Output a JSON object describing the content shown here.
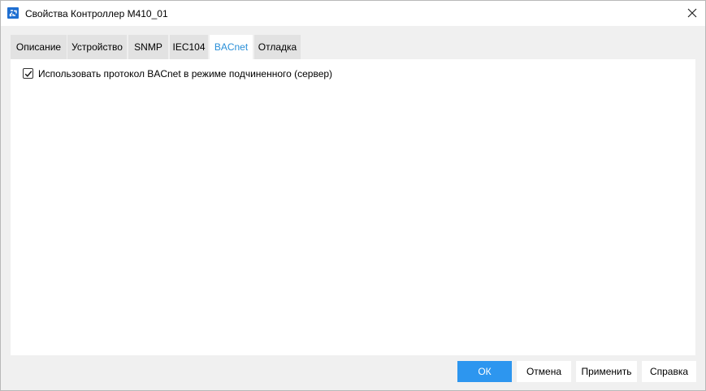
{
  "window": {
    "title": "Свойства Контроллер М410_01",
    "icon": "app-icon",
    "close_icon": "close-icon"
  },
  "tabs": [
    {
      "label": "Описание",
      "active": false
    },
    {
      "label": "Устройство",
      "active": false
    },
    {
      "label": "SNMP",
      "active": false
    },
    {
      "label": "IEC104",
      "active": false
    },
    {
      "label": "BACnet",
      "active": true
    },
    {
      "label": "Отладка",
      "active": false
    }
  ],
  "bacnet": {
    "use_bacnet_checkbox": {
      "label": "Использовать протокол BACnet в режиме подчиненного (сервер)",
      "checked": true
    }
  },
  "buttons": {
    "ok": "ОК",
    "cancel": "Отмена",
    "apply": "Применить",
    "help": "Справка"
  },
  "colors": {
    "accent": "#2d96ef",
    "active_tab_text": "#2a8fd8",
    "tab_bg": "#e2e2e2",
    "dialog_bg": "#f0f0f0"
  }
}
